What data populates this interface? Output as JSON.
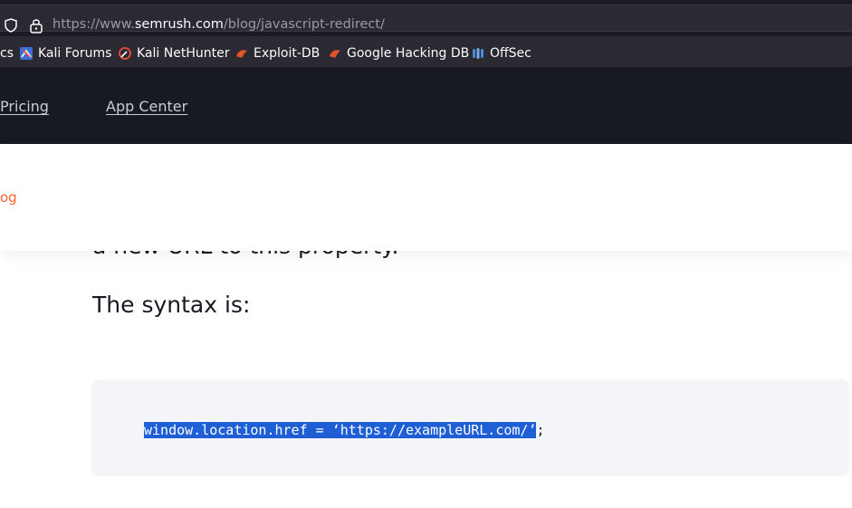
{
  "browser": {
    "url_prefix": "https://www.",
    "url_host": "semrush.com",
    "url_path": "/blog/javascript-redirect/",
    "shield_icon": "shield-icon",
    "lock_icon": "lock-icon"
  },
  "bookmarks": [
    {
      "label": "cs",
      "icon": "none"
    },
    {
      "label": "Kali Forums",
      "icon": "kali-forums-icon"
    },
    {
      "label": "Kali NetHunter",
      "icon": "kali-nethunter-icon"
    },
    {
      "label": "Exploit-DB",
      "icon": "exploit-db-icon"
    },
    {
      "label": "Google Hacking DB",
      "icon": "ghdb-icon"
    },
    {
      "label": "OffSec",
      "icon": "offsec-icon"
    }
  ],
  "site_nav": {
    "pricing": "Pricing",
    "app_center": "App Center"
  },
  "breadcrumb": {
    "label": "og"
  },
  "article": {
    "prev_line": "a new URL to this property.",
    "syntax_heading": "The syntax is:",
    "code_selected": "window.location.href = ‘https://exampleURL.com/’",
    "code_rest": ";"
  },
  "colors": {
    "accent": "#ff642d",
    "selection": "#1e5fd6",
    "nav_bg": "#171a22"
  }
}
